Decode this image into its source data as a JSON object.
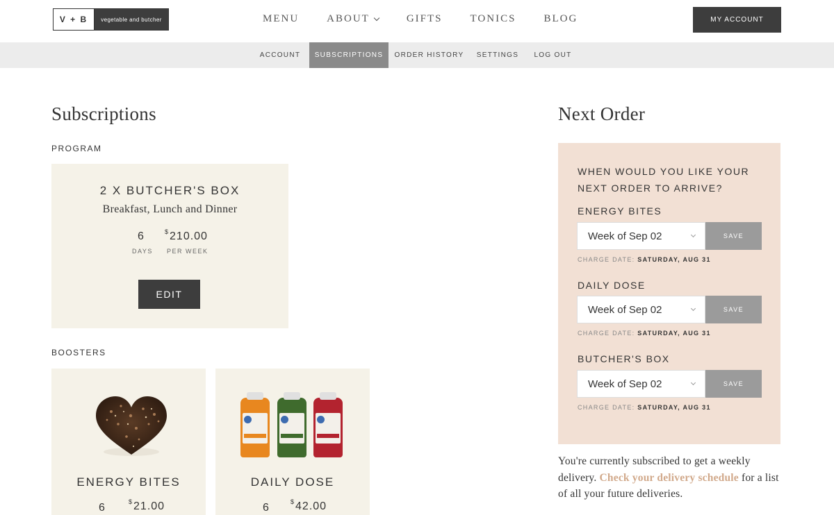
{
  "header": {
    "logo_mark": "V + B",
    "logo_name": "vegetable and butcher",
    "nav": [
      "MENU",
      "ABOUT",
      "GIFTS",
      "TONICS",
      "BLOG"
    ],
    "account_button": "MY ACCOUNT"
  },
  "subnav": {
    "items": [
      "ACCOUNT",
      "SUBSCRIPTIONS",
      "ORDER HISTORY",
      "SETTINGS",
      "LOG OUT"
    ],
    "active": "SUBSCRIPTIONS"
  },
  "subscriptions": {
    "title": "Subscriptions",
    "program_label": "PROGRAM",
    "program": {
      "title": "2 X  BUTCHER'S BOX",
      "subtitle": "Breakfast, Lunch and Dinner",
      "days_value": "6",
      "days_label": "DAYS",
      "price_symbol": "$",
      "price_value": "210.00",
      "price_label": "PER WEEK",
      "edit_label": "EDIT"
    },
    "boosters_label": "BOOSTERS",
    "boosters": [
      {
        "title": "ENERGY BITES",
        "days": "6",
        "price_symbol": "$",
        "price": "21.00"
      },
      {
        "title": "DAILY DOSE",
        "days": "6",
        "price_symbol": "$",
        "price": "42.00"
      }
    ]
  },
  "next_order": {
    "title": "Next Order",
    "question": "WHEN WOULD YOU LIKE YOUR NEXT ORDER TO ARRIVE?",
    "items": [
      {
        "name": "ENERGY BITES",
        "week": "Week of Sep 02",
        "save": "SAVE",
        "charge_label": "CHARGE DATE:",
        "charge_date": "SATURDAY, AUG 31"
      },
      {
        "name": "DAILY DOSE",
        "week": "Week of Sep 02",
        "save": "SAVE",
        "charge_label": "CHARGE DATE:",
        "charge_date": "SATURDAY, AUG 31"
      },
      {
        "name": "BUTCHER'S BOX",
        "week": "Week of Sep 02",
        "save": "SAVE",
        "charge_label": "CHARGE DATE:",
        "charge_date": "SATURDAY, AUG 31"
      }
    ],
    "note_before": "You're currently subscribed to get a weekly delivery. ",
    "note_link": "Check your delivery schedule",
    "note_after": " for a list of all your future deliveries."
  },
  "colors": {
    "dark_button": "#3d3d3d",
    "card_bg": "#f5f2e8",
    "order_panel_bg": "#f2e0d4",
    "link": "#d1a98b",
    "save_button": "#9b9b9b"
  }
}
